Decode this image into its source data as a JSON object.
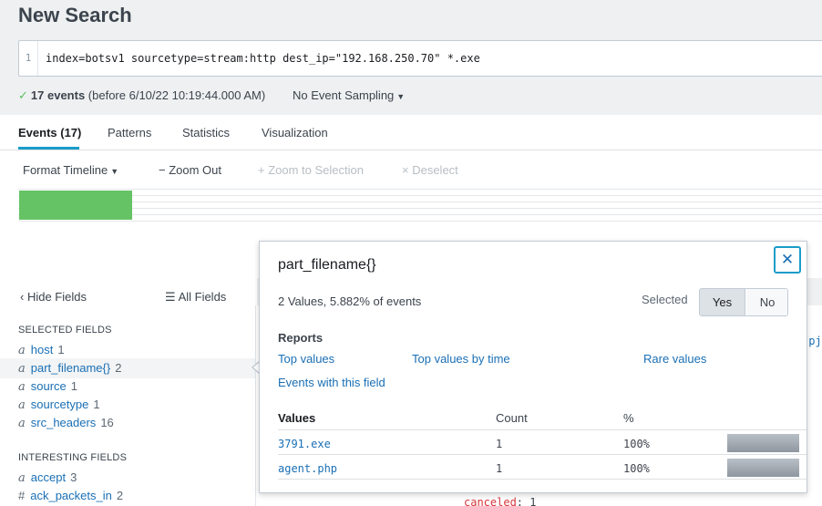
{
  "page": {
    "title": "New Search"
  },
  "search": {
    "line_number": "1",
    "query": "index=botsv1 sourcetype=stream:http dest_ip=\"192.168.250.70\" *.exe"
  },
  "status": {
    "check_glyph": "✓",
    "events_count": "17 events",
    "before_text": "(before 6/10/22 10:19:44.000 AM)",
    "sampling_label": "No Event Sampling"
  },
  "tabs": [
    {
      "label": "Events (17)",
      "active": true
    },
    {
      "label": "Patterns"
    },
    {
      "label": "Statistics"
    },
    {
      "label": "Visualization"
    }
  ],
  "timeline_toolbar": {
    "format_timeline": "Format Timeline",
    "zoom_out": "− Zoom Out",
    "zoom_to_selection": "+ Zoom to Selection",
    "deselect": "× Deselect"
  },
  "timeline": {
    "bar_color": "#65c365"
  },
  "sidebar": {
    "hide_fields": "‹ Hide Fields",
    "all_fields": "All Fields",
    "selected_heading": "SELECTED FIELDS",
    "selected_fields": [
      {
        "type": "a",
        "name": "host",
        "count": "1"
      },
      {
        "type": "a",
        "name": "part_filename{}",
        "count": "2"
      },
      {
        "type": "a",
        "name": "source",
        "count": "1"
      },
      {
        "type": "a",
        "name": "sourcetype",
        "count": "1"
      },
      {
        "type": "a",
        "name": "src_headers",
        "count": "16"
      }
    ],
    "interesting_heading": "INTERESTING FIELDS",
    "interesting_fields": [
      {
        "type": "a",
        "name": "accept",
        "count": "3"
      },
      {
        "type": "#",
        "name": "ack_packets_in",
        "count": "2"
      }
    ]
  },
  "events_fragments": {
    "right_edge": "/pj",
    "bottom_key": "canceled",
    "bottom_value": ": 1"
  },
  "popup": {
    "title": "part_filename{}",
    "close_glyph": "✕",
    "summary": "2 Values, 5.882% of events",
    "selected_label": "Selected",
    "yes": "Yes",
    "no": "No",
    "reports_heading": "Reports",
    "reports": {
      "top_values": "Top values",
      "top_values_by_time": "Top values by time",
      "rare_values": "Rare values",
      "events_with_field": "Events with this field"
    },
    "table": {
      "headers": {
        "values": "Values",
        "count": "Count",
        "percent": "%"
      },
      "rows": [
        {
          "value": "3791.exe",
          "count": "1",
          "percent": "100%",
          "fraction": 1.0
        },
        {
          "value": "agent.php",
          "count": "1",
          "percent": "100%",
          "fraction": 1.0
        }
      ]
    }
  },
  "colors": {
    "accent": "#1a9cc9",
    "link": "#1a6fb5",
    "success": "#5cc05c"
  }
}
